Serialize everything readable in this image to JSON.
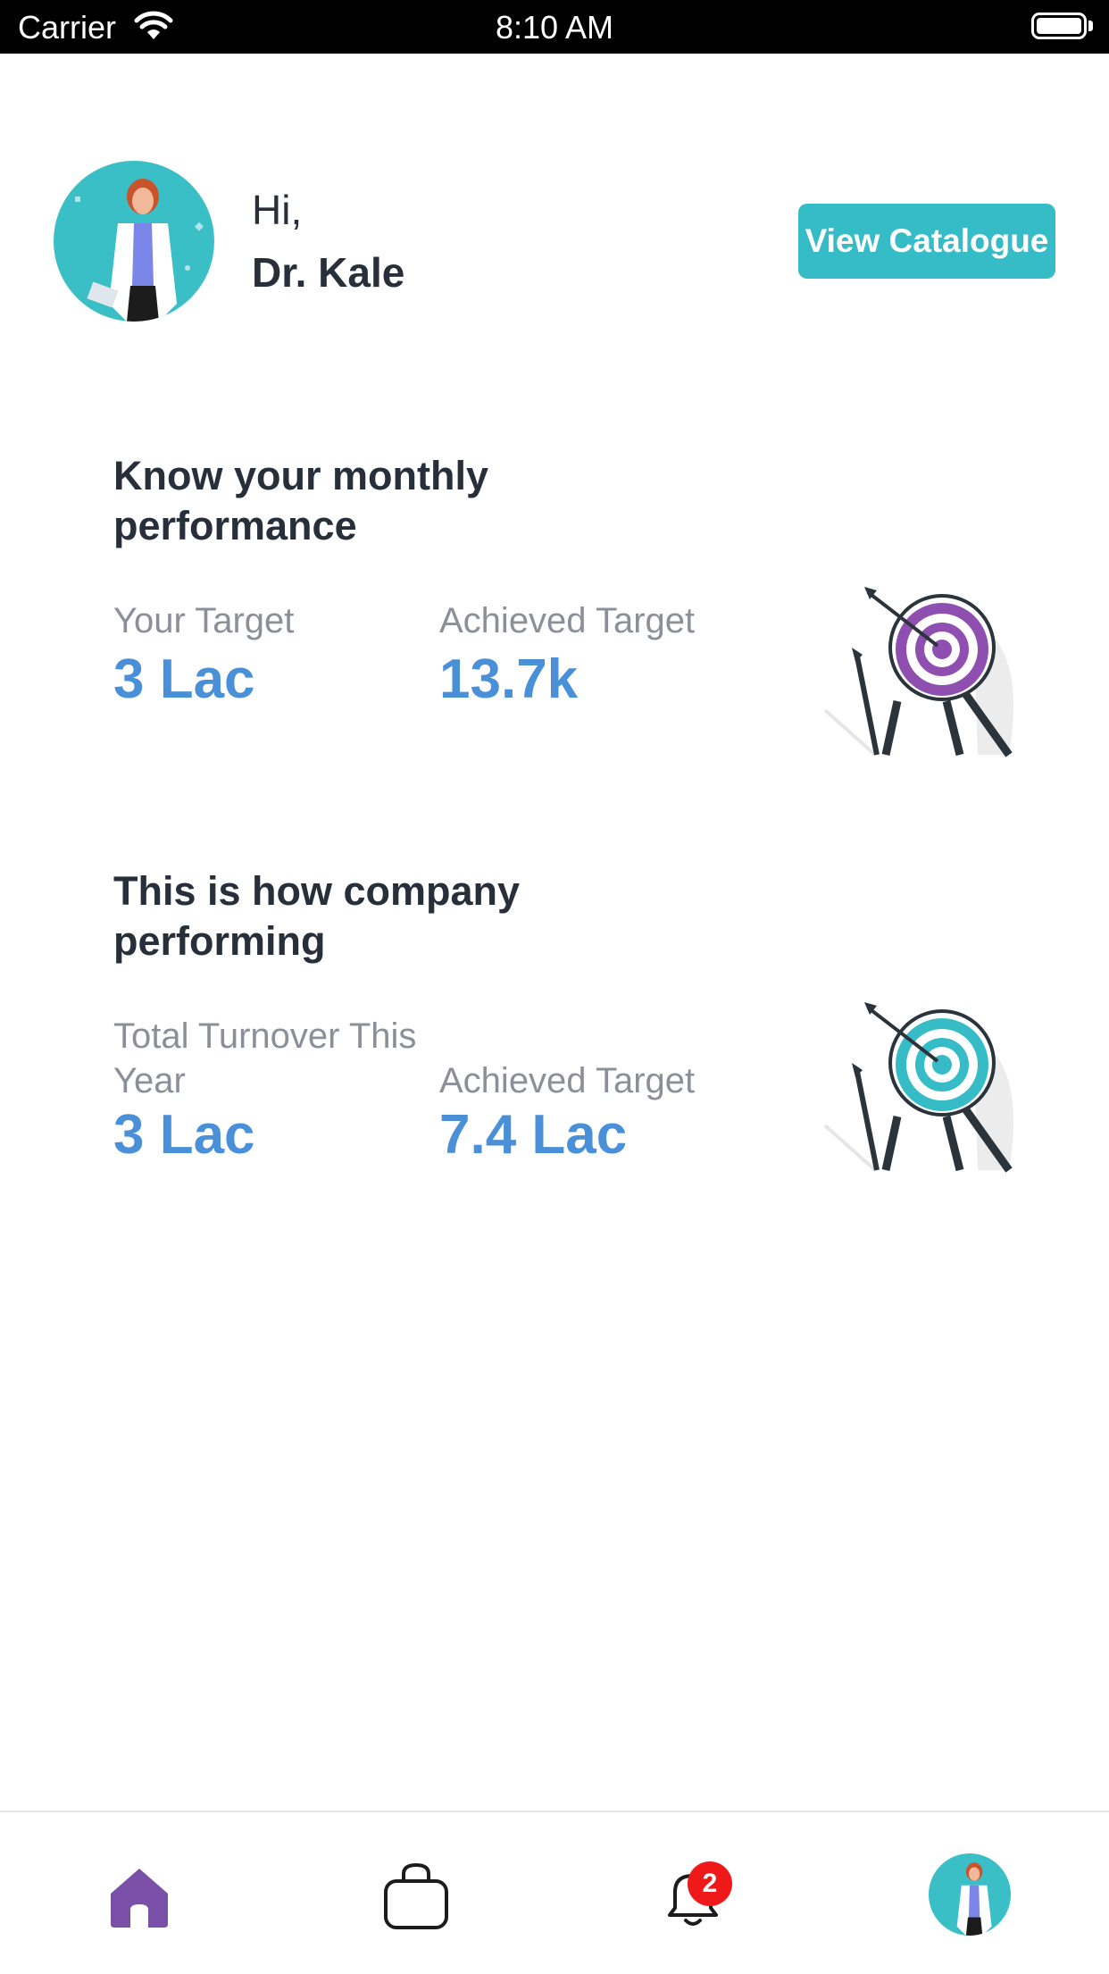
{
  "status_bar": {
    "carrier": "Carrier",
    "time": "8:10 AM"
  },
  "header": {
    "greeting": "Hi,",
    "name": "Dr. Kale",
    "catalogue_button": "View Catalogue"
  },
  "monthly_card": {
    "title": "Know your monthly performance",
    "target_label": "Your Target",
    "target_value": "3 Lac",
    "achieved_label": "Achieved Target",
    "achieved_value": "13.7k",
    "accent_color": "#8e4fb1"
  },
  "company_card": {
    "title": "This is how company performing",
    "turnover_label": "Total Turnover This Year",
    "turnover_value": "3 Lac",
    "achieved_label": "Achieved Target",
    "achieved_value": "7.4 Lac",
    "accent_color": "#36bcc6"
  },
  "bottom_nav": {
    "items": [
      {
        "icon": "home-icon",
        "active": true
      },
      {
        "icon": "shopping-bag-icon",
        "active": false
      },
      {
        "icon": "bell-icon",
        "active": false
      },
      {
        "icon": "profile-avatar",
        "active": false
      }
    ],
    "notification_count": "2"
  },
  "colors": {
    "primary_teal": "#36bcc6",
    "value_blue": "#4a90d9",
    "home_purple": "#7a4fa8",
    "badge_red": "#f01919"
  }
}
